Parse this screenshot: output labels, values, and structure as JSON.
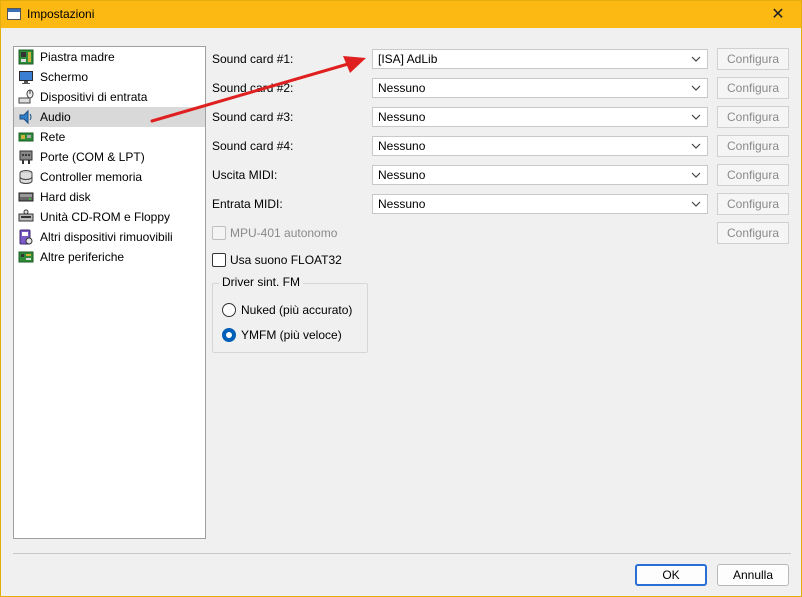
{
  "window": {
    "title": "Impostazioni",
    "close_glyph": "✕"
  },
  "sidebar": {
    "selected_index": 3,
    "items": [
      {
        "label": "Piastra madre",
        "icon": "motherboard-icon"
      },
      {
        "label": "Schermo",
        "icon": "display-icon"
      },
      {
        "label": "Dispositivi di entrata",
        "icon": "input-devices-icon"
      },
      {
        "label": "Audio",
        "icon": "speaker-icon"
      },
      {
        "label": "Rete",
        "icon": "network-icon"
      },
      {
        "label": "Porte (COM & LPT)",
        "icon": "ports-icon"
      },
      {
        "label": "Controller memoria",
        "icon": "storage-controller-icon"
      },
      {
        "label": "Hard disk",
        "icon": "hard-disk-icon"
      },
      {
        "label": "Unità CD-ROM e Floppy",
        "icon": "cdrom-floppy-icon"
      },
      {
        "label": "Altri dispositivi rimuovibili",
        "icon": "removable-devices-icon"
      },
      {
        "label": "Altre periferiche",
        "icon": "other-peripherals-icon"
      }
    ]
  },
  "audio": {
    "rows": [
      {
        "label": "Sound card #1:",
        "value": "[ISA] AdLib",
        "button": "Configura"
      },
      {
        "label": "Sound card #2:",
        "value": "Nessuno",
        "button": "Configura"
      },
      {
        "label": "Sound card #3:",
        "value": "Nessuno",
        "button": "Configura"
      },
      {
        "label": "Sound card #4:",
        "value": "Nessuno",
        "button": "Configura"
      },
      {
        "label": "Uscita MIDI:",
        "value": "Nessuno",
        "button": "Configura"
      },
      {
        "label": "Entrata MIDI:",
        "value": "Nessuno",
        "button": "Configura"
      }
    ],
    "mpu401": {
      "label": "MPU-401 autonomo",
      "checked": false,
      "enabled": false,
      "button": "Configura"
    },
    "float32": {
      "label": "Usa suono FLOAT32",
      "checked": false
    },
    "fm_driver": {
      "title": "Driver sint. FM",
      "options": [
        {
          "label": "Nuked (più accurato)",
          "checked": false
        },
        {
          "label": "YMFM (più veloce)",
          "checked": true
        }
      ]
    }
  },
  "footer": {
    "ok_label": "OK",
    "cancel_label": "Annulla"
  },
  "colors": {
    "titlebar": "#fdb913",
    "accent": "#005fb8",
    "annotation_arrow": "#e02020"
  }
}
